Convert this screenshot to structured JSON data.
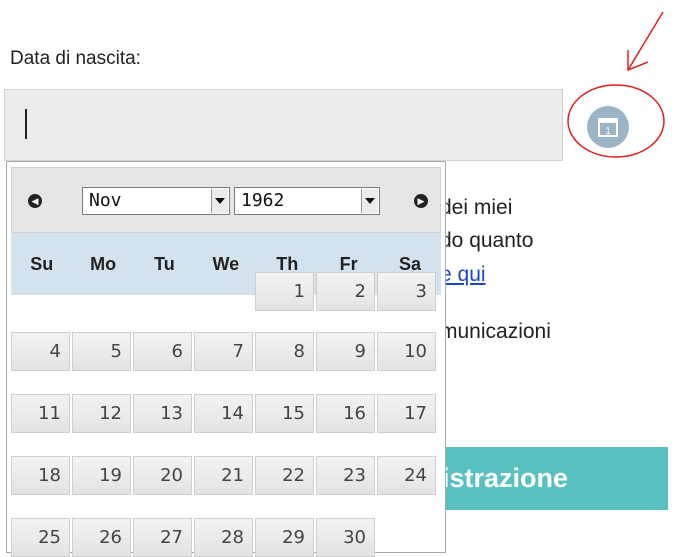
{
  "form": {
    "birthdate_label": "Data di nascita:",
    "birthdate_value": "",
    "calendar_button_icon": "calendar-icon"
  },
  "background": {
    "line1": "dei miei",
    "line2": "do quanto",
    "link": "e qui",
    "line3": "municazioni",
    "register_button": "istrazione"
  },
  "datepicker": {
    "prev_icon": "prev-month-icon",
    "next_icon": "next-month-icon",
    "month": "Nov",
    "year": "1962",
    "weekdays": [
      "Su",
      "Mo",
      "Tu",
      "We",
      "Th",
      "Fr",
      "Sa"
    ],
    "weeks": [
      [
        "",
        "",
        "",
        "",
        "1",
        "2",
        "3"
      ],
      [
        "4",
        "5",
        "6",
        "7",
        "8",
        "9",
        "10"
      ],
      [
        "11",
        "12",
        "13",
        "14",
        "15",
        "16",
        "17"
      ],
      [
        "18",
        "19",
        "20",
        "21",
        "22",
        "23",
        "24"
      ],
      [
        "25",
        "26",
        "27",
        "28",
        "29",
        "30",
        ""
      ]
    ]
  },
  "colors": {
    "header_bg": "#e6e6e6",
    "weekday_bg": "#d3e2ec",
    "button_bg": "#58c0c0",
    "annotation": "#e02020",
    "link": "#1a46c8"
  }
}
